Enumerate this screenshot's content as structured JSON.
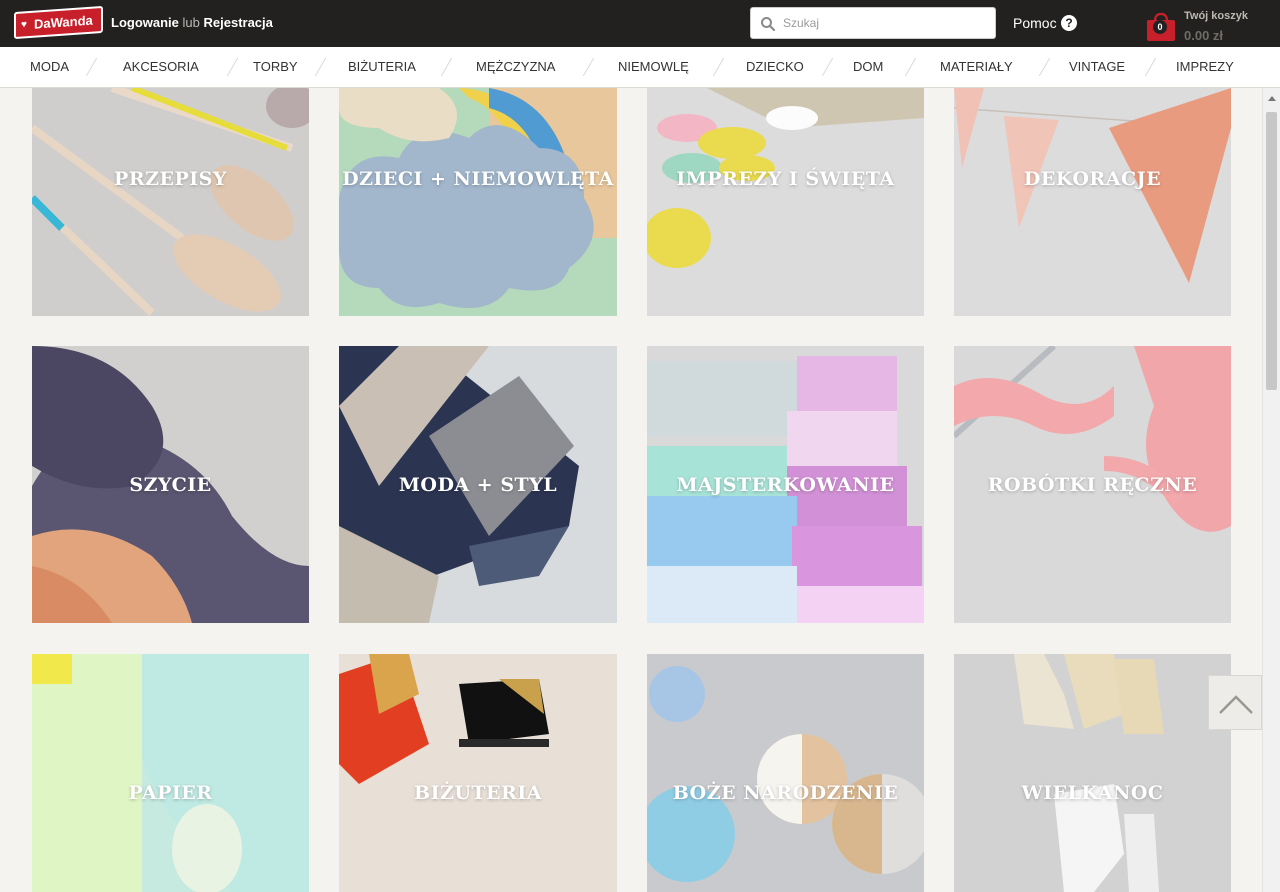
{
  "header": {
    "logo_text": "DaWanda",
    "login_label": "Logowanie",
    "or_label": "lub",
    "register_label": "Rejestracja",
    "search_placeholder": "Szukaj",
    "help_label": "Pomoc",
    "help_icon": "?",
    "cart_count": "0",
    "cart_label": "Twój koszyk",
    "cart_total": "0.00 zł"
  },
  "nav": {
    "items": [
      "MODA",
      "AKCESORIA",
      "TORBY",
      "BIŻUTERIA",
      "MĘŻCZYZNA",
      "NIEMOWLĘ",
      "DZIECKO",
      "DOM",
      "MATERIAŁY",
      "VINTAGE",
      "IMPREZY"
    ]
  },
  "categories": [
    {
      "label": "PRZEPISY"
    },
    {
      "label": "DZIECI + NIEMOWLĘTA"
    },
    {
      "label": "IMPREZY I ŚWIĘTA"
    },
    {
      "label": "DEKORACJE"
    },
    {
      "label": "SZYCIE"
    },
    {
      "label": "MODA + STYL"
    },
    {
      "label": "MAJSTERKOWANIE"
    },
    {
      "label": "ROBÓTKI RĘCZNE"
    },
    {
      "label": "PAPIER"
    },
    {
      "label": "BIŻUTERIA"
    },
    {
      "label": "BOŻE NARODZENIE"
    },
    {
      "label": "WIELKANOC"
    }
  ],
  "colors": {
    "topbar": "#222120",
    "brand_red": "#c8202a",
    "page_bg": "#f4f3ef"
  }
}
